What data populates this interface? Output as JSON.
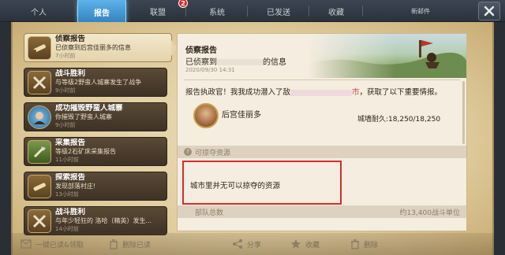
{
  "tabs": [
    {
      "label": "个人",
      "active": false
    },
    {
      "label": "报告",
      "active": true
    },
    {
      "label": "联盟",
      "active": false,
      "badge": "2"
    },
    {
      "label": "系统",
      "active": false
    },
    {
      "label": "已发送",
      "active": false
    },
    {
      "label": "收藏",
      "active": false
    },
    {
      "label": "新邮件",
      "active": false
    }
  ],
  "mail_list": [
    {
      "title": "侦察报告",
      "subtitle": "已侦察到后宫佳丽多的信息",
      "time": "7小时前",
      "icon": "telescope-icon",
      "selected": true
    },
    {
      "title": "战斗胜利",
      "subtitle": "与等级2野蛮人城寨发生了战争",
      "time": "9小时前",
      "icon": "crossed-swords-icon",
      "selected": false
    },
    {
      "title": "成功摧毁野蛮人城寨",
      "subtitle": "你摧毁了野蛮人城寨",
      "time": "9小时前",
      "icon": "hero-avatar-icon",
      "selected": false
    },
    {
      "title": "采集报告",
      "subtitle": "等级2石矿床采集报告",
      "time": "11小时前",
      "icon": "gather-axe-icon",
      "selected": false
    },
    {
      "title": "探索报告",
      "subtitle": "发现部落村庄!",
      "time": "13小时前",
      "icon": "explore-telescope-icon",
      "selected": false
    },
    {
      "title": "战斗胜利",
      "subtitle": "与年少轻狂的 洛哈（精英）发生...",
      "time": "14小时前",
      "icon": "crossed-swords-icon",
      "selected": false
    }
  ],
  "detail": {
    "title": "侦察报告",
    "subtitle_prefix": "已侦察到",
    "subtitle_suffix": "的信息",
    "date": "2020/09/30 14:31",
    "report_prefix": "报告执政官！我我成功潜入了敌",
    "report_red": "市",
    "report_suffix": "，获取了以下重要情报。",
    "target_name": "后宫佳丽多",
    "wall_label": "城墙耐久:18,250/18,250",
    "section_loot": "可掠夺资源",
    "no_loot_text": "城市里并无可以掠夺的资源",
    "section_troops": "部队总数",
    "troops_value": "约13,400战斗单位"
  },
  "actions": {
    "read_all": "一键已读&领取",
    "delete_read": "删除已读",
    "share": "分享",
    "favorite": "收藏",
    "delete": "删除"
  },
  "colors": {
    "active_tab": "#3f96d6",
    "badge": "#d8282a",
    "highlight_box": "#d42d2d",
    "parchment": "#e6d6ae"
  }
}
